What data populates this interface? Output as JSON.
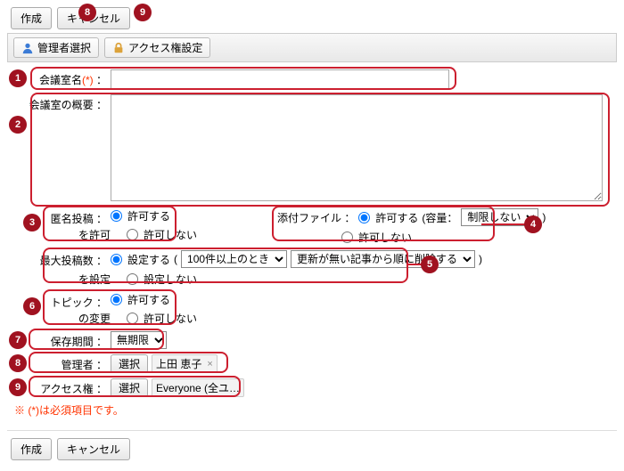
{
  "topButtons": {
    "create": "作成",
    "cancel": "キャンセル"
  },
  "toolbar": {
    "adminSelect": "管理者選択",
    "accessSettings": "アクセス権設定"
  },
  "labels": {
    "roomName": "会議室名",
    "roomNameSuffix": "：",
    "required": "(*)",
    "roomDesc": "会議室の概要  ：",
    "anonLabel": "匿名投稿 ：",
    "anonSub": "を許可",
    "attachLabel": "添付ファイル ：",
    "attachCapacity": "(容量：",
    "maxPostsLabel": "最大投稿数 ：",
    "maxPostsSub": "を設定",
    "maxPostsParen": "(",
    "maxPostsParenEnd": ")",
    "topicLabel": "トピック ：",
    "topicSub": "の変更",
    "retentionLabel": "保存期間 ：",
    "adminLabel": "管理者 ：",
    "accessLabel": "アクセス権 ：",
    "selectBtn": "選択"
  },
  "options": {
    "allow": "許可する",
    "disallow": "許可しない",
    "set": "設定する",
    "notSet": "設定しない"
  },
  "selects": {
    "capacity": "制限しない",
    "maxPostsWhen": "100件以上のとき",
    "maxPostsAction": "更新が無い記事から順に削除する",
    "retention": "無期限"
  },
  "tags": {
    "admin": "上田 恵子",
    "access": "Everyone (全ユ…"
  },
  "note": "※ (*)は必須項目です。",
  "callouts": [
    "1",
    "2",
    "3",
    "4",
    "5",
    "6",
    "7",
    "8",
    "9"
  ]
}
